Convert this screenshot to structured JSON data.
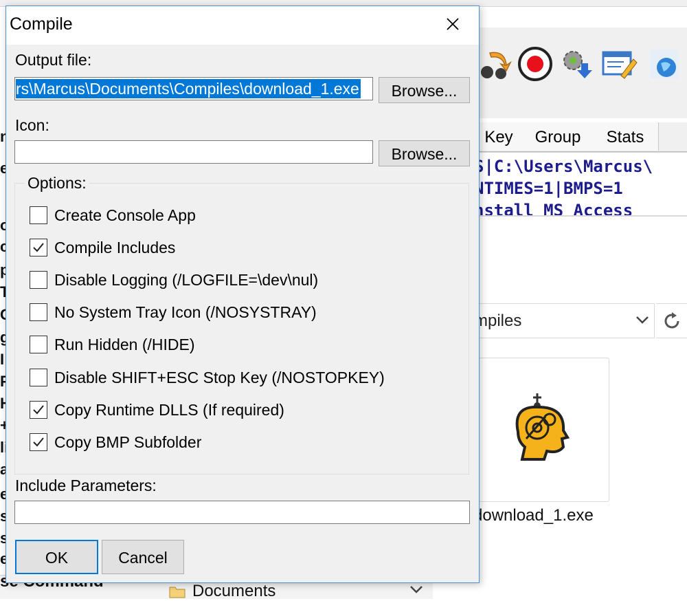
{
  "background": {
    "tabs": [
      "Key",
      "Group",
      "Stats"
    ],
    "code_lines": [
      "S|C:\\Users\\Marcus\\",
      "NTIMES=1|BMPS=1",
      "nstall MS Access"
    ],
    "breadcrumb": "mpiles",
    "file_name": "download_1.exe",
    "bottom_command": "se Command",
    "bottom_folder": "Documents",
    "left_fragments": [
      "n",
      "e",
      "o",
      "c",
      "p",
      "T",
      "C",
      "g",
      "I",
      "F",
      "H",
      "+",
      "li",
      "a",
      "e",
      "s",
      "s",
      "e"
    ]
  },
  "dialog": {
    "title": "Compile",
    "output_label": "Output file:",
    "output_value": "rs\\Marcus\\Documents\\Compiles\\download_1.exe",
    "browse_label": "Browse...",
    "icon_label": "Icon:",
    "icon_value": "",
    "options_label": "Options:",
    "options": [
      {
        "label": "Create Console App",
        "checked": false
      },
      {
        "label": "Compile Includes",
        "checked": true
      },
      {
        "label": "Disable Logging (/LOGFILE=\\dev\\nul)",
        "checked": false
      },
      {
        "label": "No System Tray Icon (/NOSYSTRAY)",
        "checked": false
      },
      {
        "label": "Run Hidden (/HIDE)",
        "checked": false
      },
      {
        "label": "Disable SHIFT+ESC Stop Key (/NOSTOPKEY)",
        "checked": false
      },
      {
        "label": "Copy Runtime DLLS (If required)",
        "checked": true
      },
      {
        "label": "Copy BMP Subfolder",
        "checked": true
      }
    ],
    "include_params_label": "Include Parameters:",
    "include_params_value": "",
    "ok_label": "OK",
    "cancel_label": "Cancel"
  }
}
